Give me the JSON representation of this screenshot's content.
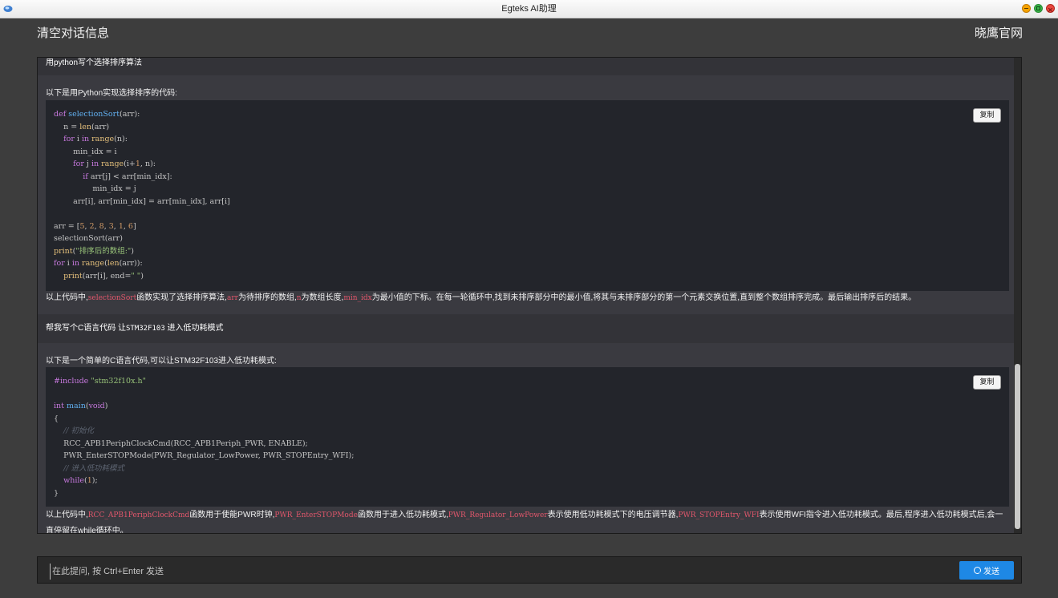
{
  "window": {
    "title": "Egteks AI助理"
  },
  "header": {
    "clear_label": "清空对话信息",
    "site_label": "晓鹰官网"
  },
  "messages": {
    "q1": {
      "text": "用python写个选择排序算法"
    },
    "a1": {
      "intro": "以下是用Python实现选择排序的代码:",
      "copy_label": "复制",
      "code": [
        [
          [
            "kw",
            "def "
          ],
          [
            "fn",
            "selectionSort"
          ],
          [
            "",
            "(arr):"
          ]
        ],
        [
          [
            "",
            "    n = "
          ],
          [
            "bi",
            "len"
          ],
          [
            "",
            "(arr)"
          ]
        ],
        [
          [
            "kw",
            "    for "
          ],
          [
            "",
            "i "
          ],
          [
            "kw",
            "in "
          ],
          [
            "bi",
            "range"
          ],
          [
            "",
            "(n):"
          ]
        ],
        [
          [
            "",
            "        min_idx = i"
          ]
        ],
        [
          [
            "kw",
            "        for "
          ],
          [
            "",
            "j "
          ],
          [
            "kw",
            "in "
          ],
          [
            "bi",
            "range"
          ],
          [
            "",
            "(i+"
          ],
          [
            "num",
            "1"
          ],
          [
            "",
            ", n):"
          ]
        ],
        [
          [
            "kw",
            "            if "
          ],
          [
            "",
            "arr[j] < arr[min_idx]:"
          ]
        ],
        [
          [
            "",
            "                min_idx = j"
          ]
        ],
        [
          [
            "",
            "        arr[i], arr[min_idx] = arr[min_idx], arr[i]"
          ]
        ],
        [
          [
            "",
            ""
          ]
        ],
        [
          [
            "",
            "arr = ["
          ],
          [
            "num",
            "5"
          ],
          [
            "",
            ", "
          ],
          [
            "num",
            "2"
          ],
          [
            "",
            ", "
          ],
          [
            "num",
            "8"
          ],
          [
            "",
            ", "
          ],
          [
            "num",
            "3"
          ],
          [
            "",
            ", "
          ],
          [
            "num",
            "1"
          ],
          [
            "",
            ", "
          ],
          [
            "num",
            "6"
          ],
          [
            "",
            "]"
          ]
        ],
        [
          [
            "",
            "selectionSort(arr)"
          ]
        ],
        [
          [
            "bi",
            "print"
          ],
          [
            "",
            "("
          ],
          [
            "str",
            "\"排序后的数组:\""
          ],
          [
            "",
            ")"
          ]
        ],
        [
          [
            "kw",
            "for "
          ],
          [
            "",
            "i "
          ],
          [
            "kw",
            "in "
          ],
          [
            "bi",
            "range"
          ],
          [
            "",
            "("
          ],
          [
            "bi",
            "len"
          ],
          [
            "",
            "(arr)):"
          ]
        ],
        [
          [
            "bi",
            "    print"
          ],
          [
            "",
            "(arr[i], end="
          ],
          [
            "str",
            "\" \""
          ],
          [
            "",
            ")"
          ]
        ]
      ],
      "explain": [
        [
          "",
          "以上代码中,"
        ],
        [
          "c",
          "selectionSort"
        ],
        [
          "",
          "函数实现了选择排序算法,"
        ],
        [
          "c",
          "arr"
        ],
        [
          "",
          "为待排序的数组,"
        ],
        [
          "c",
          "n"
        ],
        [
          "",
          "为数组长度,"
        ],
        [
          "c",
          "min_idx"
        ],
        [
          "",
          "为最小值的下标。在每一轮循环中,找到未排序部分中的最小值,将其与未排序部分的第一个元素交换位置,直到整个数组排序完成。最后输出排序后的结果。"
        ]
      ]
    },
    "q2": {
      "prefix": "帮我写个C语言代码 让",
      "mono": "STM32F103",
      "suffix": "  进入低功耗模式"
    },
    "a2": {
      "intro": "以下是一个简单的C语言代码,可以让STM32F103进入低功耗模式:",
      "copy_label": "复制",
      "code": [
        [
          [
            "pp",
            "#include "
          ],
          [
            "str",
            "\"stm32f10x.h\""
          ]
        ],
        [
          [
            "",
            ""
          ]
        ],
        [
          [
            "kw",
            "int "
          ],
          [
            "fn",
            "main"
          ],
          [
            "",
            "("
          ],
          [
            "kw",
            "void"
          ],
          [
            "",
            ")"
          ]
        ],
        [
          [
            "",
            "{"
          ]
        ],
        [
          [
            "cm",
            "    // 初始化"
          ]
        ],
        [
          [
            "",
            "    RCC_APB1PeriphClockCmd(RCC_APB1Periph_PWR, ENABLE);"
          ]
        ],
        [
          [
            "",
            "    PWR_EnterSTOPMode(PWR_Regulator_LowPower, PWR_STOPEntry_WFI);"
          ]
        ],
        [
          [
            "cm",
            "    // 进入低功耗模式"
          ]
        ],
        [
          [
            "kw",
            "    while"
          ],
          [
            "",
            "("
          ],
          [
            "num",
            "1"
          ],
          [
            "",
            ");"
          ]
        ],
        [
          [
            "",
            "}"
          ]
        ]
      ],
      "explain": [
        [
          "",
          "以上代码中,"
        ],
        [
          "c",
          "RCC_APB1PeriphClockCmd"
        ],
        [
          "",
          "函数用于使能PWR时钟,"
        ],
        [
          "c",
          "PWR_EnterSTOPMode"
        ],
        [
          "",
          "函数用于进入低功耗模式,"
        ],
        [
          "c",
          "PWR_Regulator_LowPower"
        ],
        [
          "",
          "表示使用低功耗模式下的电压调节器,"
        ],
        [
          "c",
          "PWR_STOPEntry_WFI"
        ],
        [
          "",
          "表示使用WFI指令进入低功耗模式。最后,程序进入低功耗模式后,会一直停留在while循环中。"
        ]
      ]
    }
  },
  "input": {
    "placeholder": "在此提问, 按 Ctrl+Enter 发送",
    "send_label": "发送"
  },
  "colors": {
    "accent": "#1e88e5",
    "inline_code": "#e0566b",
    "code_bg": "#23252b"
  }
}
